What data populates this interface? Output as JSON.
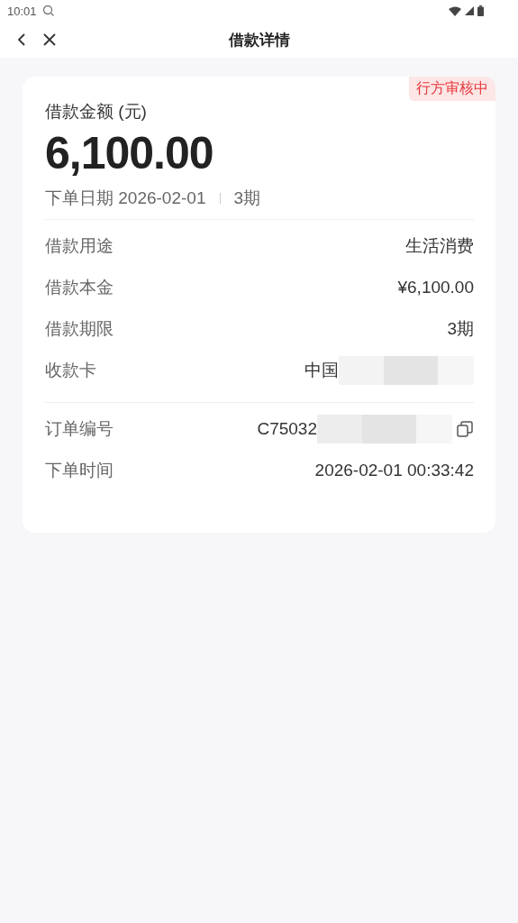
{
  "status_bar": {
    "time": "10:01"
  },
  "nav": {
    "title": "借款详情"
  },
  "summary": {
    "status_badge": "行方审核中",
    "amount_label": "借款金额 (元)",
    "amount": "6,100.00",
    "date_label": "下单日期 2026-02-01",
    "term": "3期"
  },
  "sections": [
    {
      "rows": [
        {
          "label": "借款用途",
          "value": "生活消费",
          "kind": "text",
          "redacted": false
        },
        {
          "label": "借款本金",
          "value": "¥6,100.00",
          "kind": "text",
          "redacted": false
        },
        {
          "label": "借款期限",
          "value": "3期",
          "kind": "text",
          "redacted": false
        },
        {
          "label": "收款卡",
          "value": "中国",
          "kind": "text",
          "redacted": true
        }
      ]
    },
    {
      "rows": [
        {
          "label": "订单编号",
          "value": "C75032",
          "kind": "copyable",
          "redacted": true
        },
        {
          "label": "下单时间",
          "value": "2026-02-01 00:33:42",
          "kind": "text",
          "redacted": false
        }
      ]
    }
  ]
}
